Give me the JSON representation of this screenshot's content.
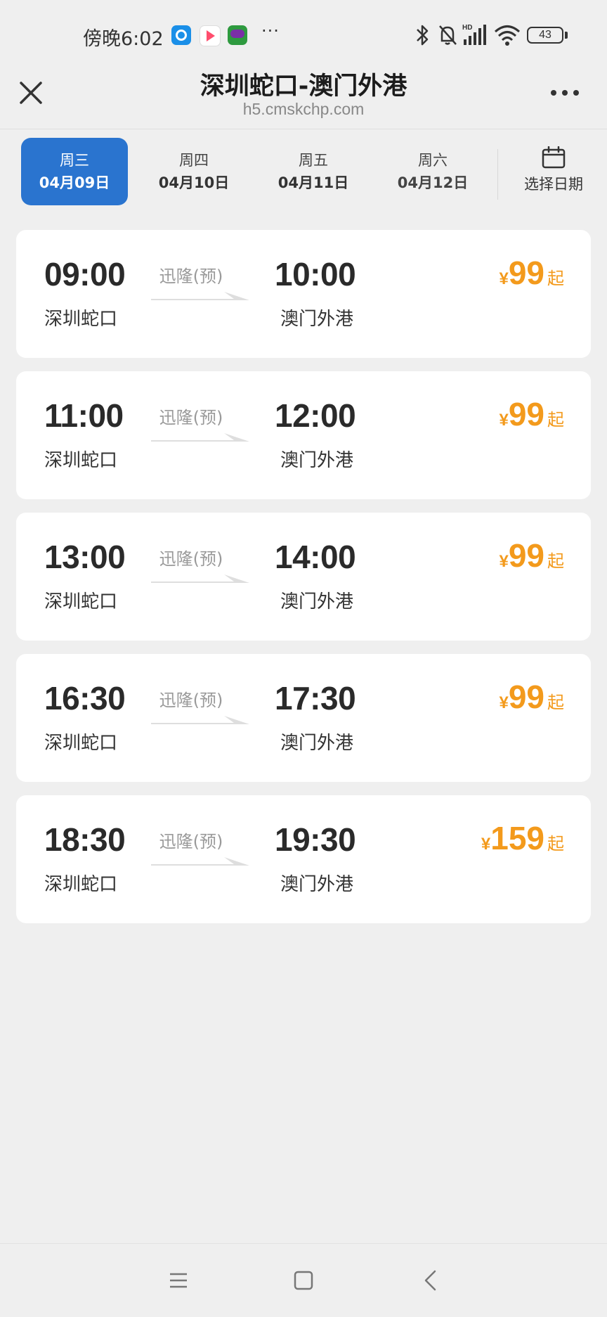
{
  "status_bar": {
    "time": "傍晚6:02",
    "more": "···",
    "battery": "43",
    "icons": [
      "app-browser-icon",
      "app-video-icon",
      "app-game-icon",
      "bluetooth-icon",
      "mute-icon",
      "signal-icon",
      "wifi-icon",
      "battery-icon"
    ]
  },
  "header": {
    "title": "深圳蛇口-澳门外港",
    "subtitle": "h5.cmskchp.com"
  },
  "date_tabs": [
    {
      "weekday": "周三",
      "date": "04月09日",
      "active": true
    },
    {
      "weekday": "周四",
      "date": "04月10日",
      "active": false
    },
    {
      "weekday": "周五",
      "date": "04月11日",
      "active": false
    },
    {
      "weekday": "周六",
      "date": "04月12日",
      "active": false
    }
  ],
  "pick_date": {
    "label": "选择日期",
    "icon": "calendar-icon"
  },
  "trips": [
    {
      "dep_time": "09:00",
      "dep_port": "深圳蛇口",
      "ship": "迅隆(预)",
      "arr_time": "10:00",
      "arr_port": "澳门外港",
      "currency": "¥",
      "price": "99",
      "suffix": "起"
    },
    {
      "dep_time": "11:00",
      "dep_port": "深圳蛇口",
      "ship": "迅隆(预)",
      "arr_time": "12:00",
      "arr_port": "澳门外港",
      "currency": "¥",
      "price": "99",
      "suffix": "起"
    },
    {
      "dep_time": "13:00",
      "dep_port": "深圳蛇口",
      "ship": "迅隆(预)",
      "arr_time": "14:00",
      "arr_port": "澳门外港",
      "currency": "¥",
      "price": "99",
      "suffix": "起"
    },
    {
      "dep_time": "16:30",
      "dep_port": "深圳蛇口",
      "ship": "迅隆(预)",
      "arr_time": "17:30",
      "arr_port": "澳门外港",
      "currency": "¥",
      "price": "99",
      "suffix": "起"
    },
    {
      "dep_time": "18:30",
      "dep_port": "深圳蛇口",
      "ship": "迅隆(预)",
      "arr_time": "19:30",
      "arr_port": "澳门外港",
      "currency": "¥",
      "price": "159",
      "suffix": "起"
    }
  ],
  "colors": {
    "accent": "#2a74cf",
    "price": "#f39a1c",
    "background": "#efefef"
  }
}
